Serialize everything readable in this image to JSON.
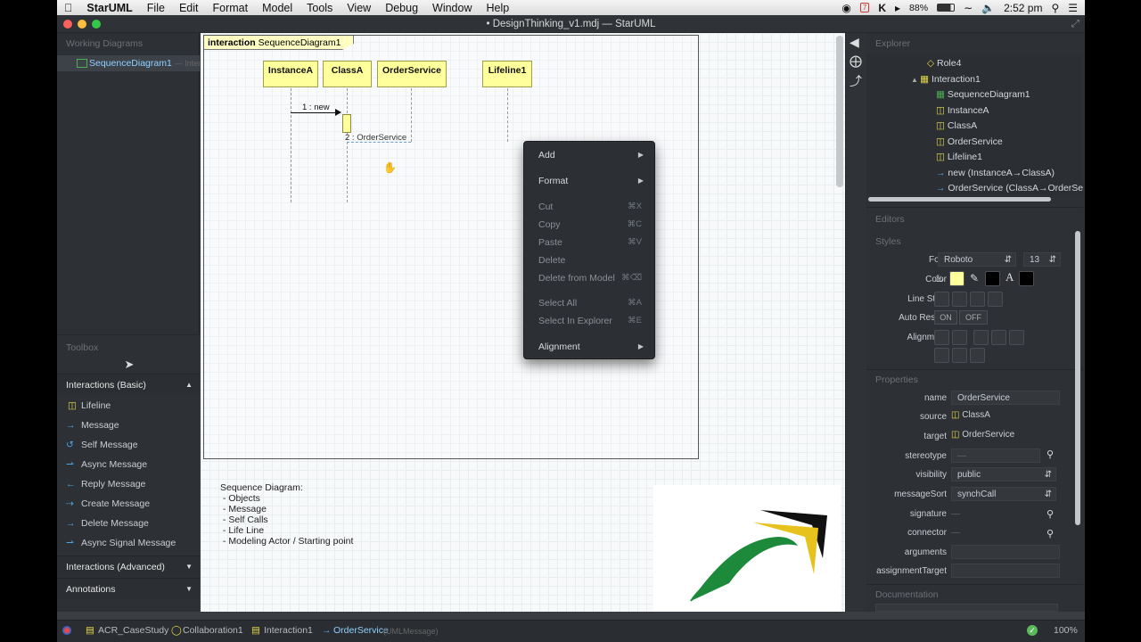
{
  "menubar": {
    "apple": "",
    "app": "StarUML",
    "items": [
      "File",
      "Edit",
      "Format",
      "Model",
      "Tools",
      "View",
      "Debug",
      "Window",
      "Help"
    ],
    "battery": "88%",
    "time": "2:52 pm",
    "date_badge": "7"
  },
  "window": {
    "title": "• DesignThinking_v1.mdj — StarUML"
  },
  "working_diagrams": {
    "header": "Working Diagrams",
    "item": "SequenceDiagram1",
    "item_suffix": "— Interact"
  },
  "toolbox": {
    "header": "Toolbox",
    "basic_label": "Interactions (Basic)",
    "items": [
      "Lifeline",
      "Message",
      "Self Message",
      "Async Message",
      "Reply Message",
      "Create Message",
      "Delete Message",
      "Async Signal Message"
    ],
    "advanced_label": "Interactions (Advanced)",
    "annotations_label": "Annotations"
  },
  "diagram": {
    "frame_keyword": "interaction",
    "frame_name": "SequenceDiagram1",
    "lifelines": [
      "InstanceA",
      "ClassA",
      "OrderService",
      "Lifeline1"
    ],
    "msg1": "1 : new",
    "msg2": "2 : OrderService"
  },
  "note": {
    "text": "Sequence Diagram:\n - Objects\n - Message\n - Self Calls\n - Life Line\n - Modeling Actor / Starting point"
  },
  "context_menu": {
    "add": "Add",
    "format": "Format",
    "cut": "Cut",
    "cut_sc": "⌘X",
    "copy": "Copy",
    "copy_sc": "⌘C",
    "paste": "Paste",
    "paste_sc": "⌘V",
    "delete": "Delete",
    "delete_model": "Delete from Model",
    "delete_model_sc": "⌘⌫",
    "select_all": "Select All",
    "select_all_sc": "⌘A",
    "select_explorer": "Select In Explorer",
    "select_explorer_sc": "⌘E",
    "alignment": "Alignment"
  },
  "explorer": {
    "header": "Explorer",
    "items": [
      "Role4",
      "Interaction1",
      "SequenceDiagram1",
      "InstanceA",
      "ClassA",
      "OrderService",
      "Lifeline1",
      "new (InstanceA→ClassA)",
      "OrderService (ClassA→OrderServ"
    ]
  },
  "editors": {
    "header": "Editors",
    "styles": "Styles",
    "font_label": "Font",
    "font_value": "Roboto",
    "font_size": "13",
    "color_label": "Color",
    "line_style_label": "Line Style",
    "auto_resize_label": "Auto Resize",
    "on": "ON",
    "off": "OFF",
    "alignment_label": "Alignment",
    "colors": {
      "fill": "#ffff9c",
      "line": "#000000",
      "font": "#000000"
    }
  },
  "properties": {
    "header": "Properties",
    "name_label": "name",
    "name_value": "OrderService",
    "source_label": "source",
    "source_value": "ClassA",
    "target_label": "target",
    "target_value": "OrderService",
    "stereotype_label": "stereotype",
    "stereotype_value": "—",
    "visibility_label": "visibility",
    "visibility_value": "public",
    "messageSort_label": "messageSort",
    "messageSort_value": "synchCall",
    "signature_label": "signature",
    "signature_value": "—",
    "connector_label": "connector",
    "connector_value": "—",
    "arguments_label": "arguments",
    "assignmentTarget_label": "assignmentTarget"
  },
  "documentation": {
    "header": "Documentation"
  },
  "statusbar": {
    "items": [
      "ACR_CaseStudy",
      "Collaboration1",
      "Interaction1",
      "OrderService"
    ],
    "type": "(UMLMessage)",
    "zoom": "100%"
  }
}
